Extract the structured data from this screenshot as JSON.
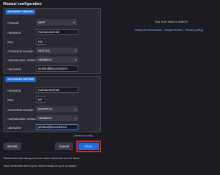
{
  "page": {
    "title": "Manual configuration"
  },
  "incoming": {
    "section_label": "INCOMING SERVER",
    "protocol": {
      "label": "Protocol:",
      "value": "IMAP"
    },
    "hostname": {
      "label": "Hostname:",
      "value": "mail.succeed.net"
    },
    "port": {
      "label": "Port:",
      "value": "993"
    },
    "security": {
      "label": "Connection security:",
      "value": "SSL/TLS"
    },
    "auth": {
      "label": "Authentication method:",
      "value": "Autodetect"
    },
    "username": {
      "label": "Username:",
      "value": "jmorland@succeed.net"
    }
  },
  "outgoing": {
    "section_label": "OUTGOING SERVER",
    "hostname": {
      "label": "Hostname:",
      "value": "mail.succeed.net"
    },
    "port": {
      "label": "Port:",
      "value": "587"
    },
    "security": {
      "label": "Connection security:",
      "value": "STARTTLS"
    },
    "auth": {
      "label": "Authentication method:",
      "value": "Autodetect"
    },
    "username": {
      "label": "Username:",
      "value": "johndoe@succeed.net"
    }
  },
  "advanced_link": "Advanced config",
  "buttons": {
    "retest": "Re-test",
    "cancel": "Cancel",
    "done": "Done"
  },
  "notes": {
    "autodetect": "Thunderbird will attempt to auto-detect fields that are left blank.",
    "credentials": "Your credentials will only be stored locally on your computer."
  },
  "sidebar": {
    "question": "Not sure what to select?",
    "links": [
      "Setup documentation",
      "Support forum",
      "Privacy policy"
    ],
    "separator": "-"
  },
  "colors": {
    "accent": "#1f6fd6",
    "highlight": "#e2202a",
    "background": "#1c1b22"
  }
}
